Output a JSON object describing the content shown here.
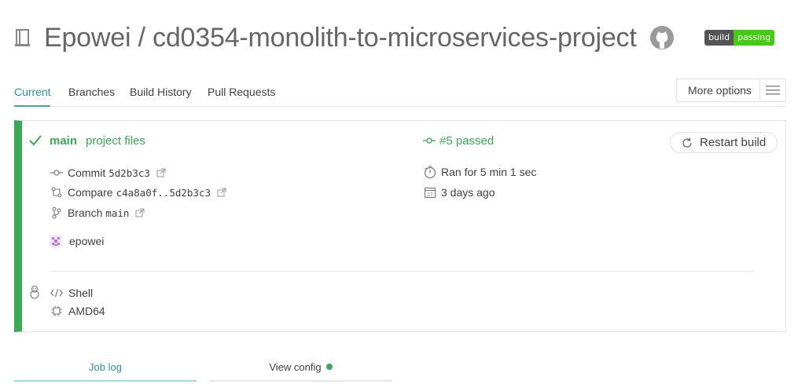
{
  "repo": {
    "title": "Epowei / cd0354-monolith-to-microservices-project",
    "badge_left": "build",
    "badge_right": "passing"
  },
  "tabs": [
    {
      "label": "Current",
      "active": true
    },
    {
      "label": "Branches"
    },
    {
      "label": "Build History"
    },
    {
      "label": "Pull Requests"
    }
  ],
  "more_options": "More options",
  "build": {
    "branch": "main",
    "message": "project files",
    "number_status": "#5 passed",
    "restart": "Restart build",
    "commit_label": "Commit",
    "commit_hash": "5d2b3c3",
    "compare_label": "Compare",
    "compare_range": "c4a8a0f..5d2b3c3",
    "branch_label": "Branch",
    "branch_name": "main",
    "author": "epowei",
    "duration": "Ran for 5 min 1 sec",
    "finished": "3 days ago",
    "language": "Shell",
    "arch": "AMD64"
  },
  "bottom_tabs": {
    "job_log": "Job log",
    "view_config": "View config"
  },
  "colors": {
    "passed": "#39aa56",
    "accent": "#2f8f9d"
  }
}
